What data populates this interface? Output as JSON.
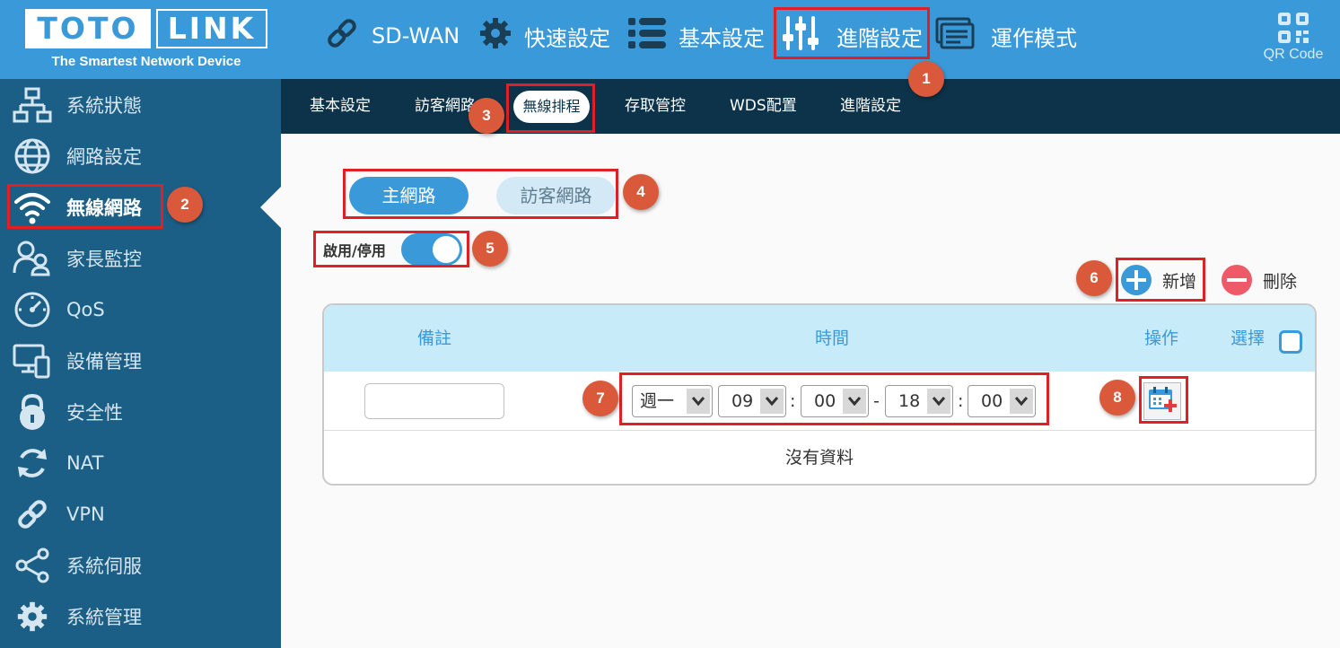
{
  "brand": {
    "logo_word1": "TOTO",
    "logo_word2": "LINK",
    "tagline": "The Smartest Network Device"
  },
  "topnav": {
    "sdwan": "SD-WAN",
    "quick": "快速設定",
    "basic": "基本設定",
    "advanced": "進階設定",
    "mode": "運作模式",
    "qr": "QR Code"
  },
  "sidebar": {
    "items": [
      {
        "label": "系統狀態",
        "icon": "topology-icon"
      },
      {
        "label": "網路設定",
        "icon": "globe-icon"
      },
      {
        "label": "無線網路",
        "icon": "wifi-icon"
      },
      {
        "label": "家長監控",
        "icon": "parental-icon"
      },
      {
        "label": "QoS",
        "icon": "speedometer-icon"
      },
      {
        "label": "設備管理",
        "icon": "devices-icon"
      },
      {
        "label": "安全性",
        "icon": "lock-icon"
      },
      {
        "label": "NAT",
        "icon": "refresh-icon"
      },
      {
        "label": "VPN",
        "icon": "link-icon"
      },
      {
        "label": "系統伺服",
        "icon": "share-icon"
      },
      {
        "label": "系統管理",
        "icon": "gear-icon"
      }
    ]
  },
  "subnav": {
    "basic": "基本設定",
    "guest": "訪客網路",
    "schedule": "無線排程",
    "access": "存取管控",
    "wds": "WDS配置",
    "advanced": "進階設定"
  },
  "content": {
    "tab_main": "主網路",
    "tab_guest": "訪客網路",
    "toggle_label": "啟用/停用",
    "toggle_on": true,
    "add": "新增",
    "delete": "刪除"
  },
  "table": {
    "col_note": "備註",
    "col_time": "時間",
    "col_action": "操作",
    "col_select": "選擇",
    "day": "週一",
    "start_hour": "09",
    "start_min": "00",
    "end_hour": "18",
    "end_min": "00",
    "colon": ":",
    "dash": "-",
    "empty": "沒有資料"
  },
  "badges": [
    "1",
    "2",
    "3",
    "4",
    "5",
    "6",
    "7",
    "8"
  ],
  "colors": {
    "header": "#3a9ad9",
    "sidebar": "#1c5f86",
    "subnav": "#0c3349",
    "accent": "#3a9ad9",
    "annotation": "#e02025",
    "badge": "#d9593a"
  }
}
